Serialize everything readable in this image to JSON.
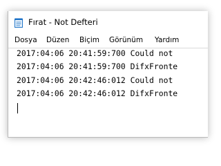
{
  "window": {
    "title": "Fırat - Not Defteri"
  },
  "menubar": {
    "items": [
      {
        "label": "Dosya"
      },
      {
        "label": "Düzen"
      },
      {
        "label": "Biçim"
      },
      {
        "label": "Görünüm"
      },
      {
        "label": "Yardım"
      }
    ]
  },
  "editor": {
    "lines": [
      "2017:04:06 20:41:59:700 Could not",
      "2017:04:06 20:41:59:700 DifxFronte",
      "2017:04:06 20:42:46:012 Could not",
      "2017:04:06 20:42:46:012 DifxFronte"
    ]
  },
  "colors": {
    "icon_blue": "#1e73c8",
    "icon_paper": "#e8f2fb"
  }
}
